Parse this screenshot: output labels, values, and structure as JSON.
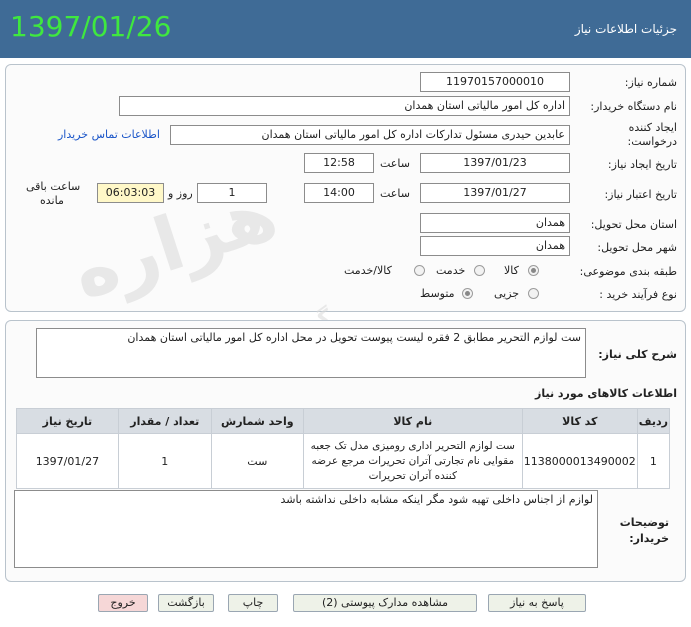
{
  "header": {
    "date": "1397/01/26",
    "title": "جزئیات اطلاعات نیاز"
  },
  "form": {
    "need_number_label": "شماره نیاز:",
    "need_number": "1197015700001​0",
    "buyer_label": "نام دستگاه خریدار:",
    "buyer": "اداره کل امور مالیاتی استان همدان",
    "requester_label_1": "ایجاد کننده",
    "requester_label_2": "درخواست:",
    "requester": "عابدین حیدری مسئول تدارکات اداره کل امور مالیاتی استان همدان",
    "contact_link": "اطلاعات تماس خریدار",
    "created_label": "تاریخ ایجاد نیاز:",
    "created_date": "1397/01/23",
    "time_label": "ساعت",
    "created_time": "12:58",
    "validity_label": "تاریخ اعتبار نیاز:",
    "validity_date": "1397/01/27",
    "validity_time": "14:00",
    "days": "1",
    "days_label": "روز و",
    "remaining": "06:03:03",
    "remaining_label_1": "ساعت باقی",
    "remaining_label_2": "مانده",
    "province_label": "استان محل تحویل:",
    "province": "همدان",
    "city_label": "شهر محل تحویل:",
    "city": "همدان",
    "category_label": "طبقه بندی موضوعی:",
    "category_options": [
      "کالا",
      "خدمت",
      "کالا/خدمت"
    ],
    "category_selected": "کالا",
    "process_label": "نوع فرآیند خرید :",
    "process_options": [
      "جزیی",
      "متوسط"
    ],
    "process_selected": "متوسط"
  },
  "summary": {
    "label": "شرح کلی نیاز:",
    "text": "ست لوازم التحریر مطابق 2 فقره لیست پیوست تحویل در محل اداره کل امور مالیاتی استان همدان"
  },
  "items": {
    "title": "اطلاعات کالاهای مورد نیاز",
    "columns": [
      "ردیف",
      "کد کالا",
      "نام کالا",
      "واحد شمارش",
      "تعداد / مقدار",
      "تاریخ نیاز"
    ],
    "rows": [
      {
        "row": "1",
        "code": "1138000013490002",
        "name": "ست لوازم التحریر اداری رومیزی مدل تک جعبه مقوایی نام تجارتی آتران تحریرات مرجع عرضه کننده آتران تحریرات",
        "unit": "ست",
        "qty": "1",
        "date": "1397/01/27"
      }
    ]
  },
  "notes": {
    "label_1": "توضیحات",
    "label_2": "خریدار:",
    "text": "لوازم از اجناس داخلی تهیه شود مگر اینکه مشابه داخلی نداشته باشد"
  },
  "buttons": {
    "reply": "پاسخ به نیاز",
    "attachments": "مشاهده مدارک پیوستی (2)",
    "print": "چاپ",
    "back": "بازگشت",
    "exit": "خروج"
  },
  "watermark": {
    "text_1": "هزاره",
    "text_2": "گسترش ارتباط"
  }
}
